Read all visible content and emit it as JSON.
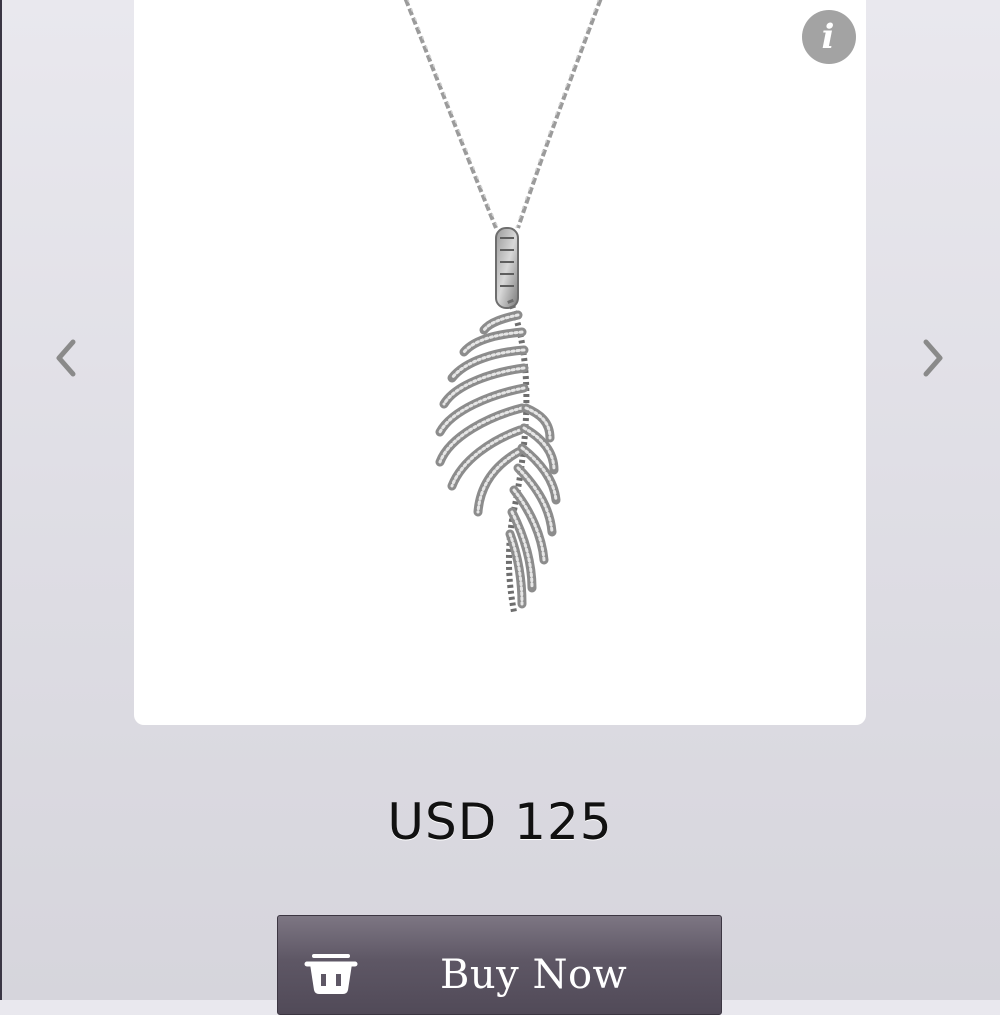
{
  "product": {
    "image_alt": "Silver feather pendant necklace",
    "price": "USD 125"
  },
  "actions": {
    "buy_label": "Buy Now",
    "info_glyph": "i"
  },
  "icons": {
    "info": "info-icon",
    "prev": "chevron-left-icon",
    "next": "chevron-right-icon",
    "basket": "basket-icon"
  },
  "colors": {
    "background": "#e2e1e7",
    "card": "#ffffff",
    "button": "#5e5765",
    "button_text": "#ffffff",
    "info_button": "#a3a3a3",
    "arrow": "#8a8a8a",
    "price_text": "#111111"
  }
}
